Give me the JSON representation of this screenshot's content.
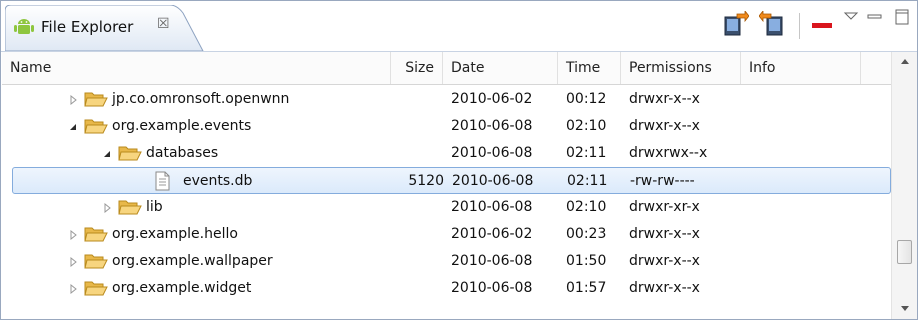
{
  "view": {
    "title": "File Explorer",
    "close_glyph": "☒",
    "icon": "android-icon"
  },
  "toolbar": {
    "buttons": [
      {
        "name": "pull-file-button",
        "icon": "pull-file-icon"
      },
      {
        "name": "push-file-button",
        "icon": "push-file-icon"
      },
      {
        "name": "delete-button",
        "icon": "delete-icon"
      },
      {
        "name": "view-menu-button",
        "icon": "chevron-down-icon"
      },
      {
        "name": "minimize-button",
        "icon": "minimize-icon"
      },
      {
        "name": "maximize-button",
        "icon": "maximize-icon"
      }
    ]
  },
  "colors": {
    "selection_border": "#84acdd",
    "folder": "#f2c86b",
    "delete_red": "#d9151d",
    "android_green": "#8ec63f"
  },
  "table": {
    "columns": [
      "Name",
      "Size",
      "Date",
      "Time",
      "Permissions",
      "Info"
    ],
    "rows": [
      {
        "name": "jp.co.omronsoft.openwnn",
        "size": "",
        "date": "2010-06-02",
        "time": "00:12",
        "permissions": "drwxr-x--x",
        "info": "",
        "type": "folder",
        "state": "collapsed",
        "depth": 1
      },
      {
        "name": "org.example.events",
        "size": "",
        "date": "2010-06-08",
        "time": "02:10",
        "permissions": "drwxr-x--x",
        "info": "",
        "type": "folder",
        "state": "expanded",
        "depth": 1
      },
      {
        "name": "databases",
        "size": "",
        "date": "2010-06-08",
        "time": "02:11",
        "permissions": "drwxrwx--x",
        "info": "",
        "type": "folder",
        "state": "expanded",
        "depth": 2
      },
      {
        "name": "events.db",
        "size": "5120",
        "date": "2010-06-08",
        "time": "02:11",
        "permissions": "-rw-rw----",
        "info": "",
        "type": "file",
        "state": "leaf",
        "depth": 3,
        "selected": true
      },
      {
        "name": "lib",
        "size": "",
        "date": "2010-06-08",
        "time": "02:10",
        "permissions": "drwxr-xr-x",
        "info": "",
        "type": "folder",
        "state": "collapsed",
        "depth": 2
      },
      {
        "name": "org.example.hello",
        "size": "",
        "date": "2010-06-02",
        "time": "00:23",
        "permissions": "drwxr-x--x",
        "info": "",
        "type": "folder",
        "state": "collapsed",
        "depth": 1
      },
      {
        "name": "org.example.wallpaper",
        "size": "",
        "date": "2010-06-08",
        "time": "01:50",
        "permissions": "drwxr-x--x",
        "info": "",
        "type": "folder",
        "state": "collapsed",
        "depth": 1
      },
      {
        "name": "org.example.widget",
        "size": "",
        "date": "2010-06-08",
        "time": "01:57",
        "permissions": "drwxr-x--x",
        "info": "",
        "type": "folder",
        "state": "collapsed",
        "depth": 1
      }
    ]
  }
}
